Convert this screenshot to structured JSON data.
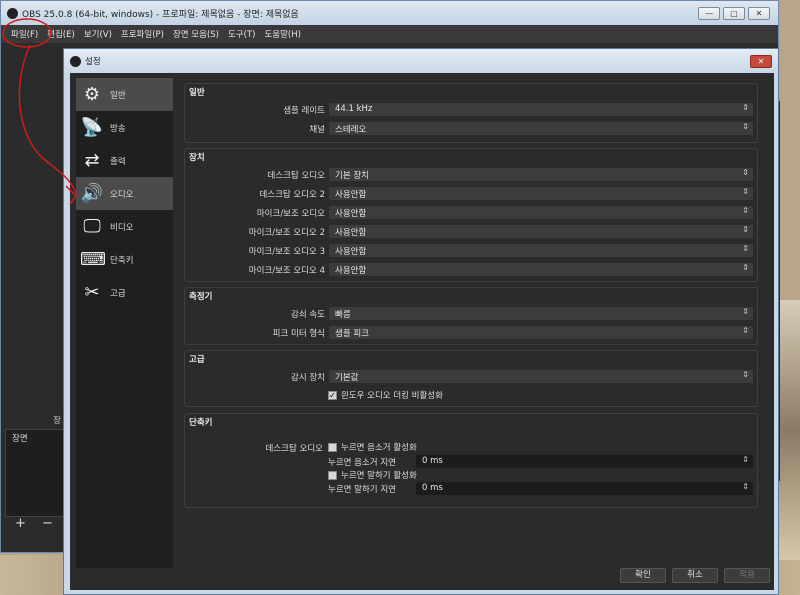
{
  "obs": {
    "title": "OBS 25.0.8 (64-bit, windows) - 프로파일: 제목없음 - 장면: 제목없음",
    "menu": [
      "파일(F)",
      "편집(E)",
      "보기(V)",
      "프로파일(P)",
      "장면 모음(S)",
      "도구(T)",
      "도움말(H)"
    ],
    "scene_header": "장",
    "scene_list_label": "장면",
    "scene_tools": "+ −"
  },
  "settings": {
    "title": "설정",
    "sidebar": [
      {
        "label": "일반",
        "icon": "gear-icon"
      },
      {
        "label": "방송",
        "icon": "antenna-icon"
      },
      {
        "label": "출력",
        "icon": "output-icon"
      },
      {
        "label": "오디오",
        "icon": "speaker-icon"
      },
      {
        "label": "비디오",
        "icon": "monitor-icon"
      },
      {
        "label": "단축키",
        "icon": "keyboard-icon"
      },
      {
        "label": "고급",
        "icon": "tools-icon"
      }
    ],
    "general": {
      "title": "일반",
      "rows": [
        {
          "label": "샘플 레이트",
          "value": "44.1 kHz"
        },
        {
          "label": "채널",
          "value": "스테레오"
        }
      ]
    },
    "devices": {
      "title": "장치",
      "rows": [
        {
          "label": "데스크탑 오디오",
          "value": "기본 장치"
        },
        {
          "label": "데스크탑 오디오 2",
          "value": "사용안함"
        },
        {
          "label": "마이크/보조 오디오",
          "value": "사용안함"
        },
        {
          "label": "마이크/보조 오디오 2",
          "value": "사용안함"
        },
        {
          "label": "마이크/보조 오디오 3",
          "value": "사용안함"
        },
        {
          "label": "마이크/보조 오디오 4",
          "value": "사용안함"
        }
      ]
    },
    "meters": {
      "title": "측정기",
      "rows": [
        {
          "label": "감쇠 속도",
          "value": "빠름"
        },
        {
          "label": "피크 미터 형식",
          "value": "샘플 피크"
        }
      ]
    },
    "advanced": {
      "title": "고급",
      "monitor_label": "감시 장치",
      "monitor_value": "기본값",
      "ducking_label": "윈도우 오디오 더킹 비활성화"
    },
    "hotkeys": {
      "title": "단축키",
      "source_label": "데스크탑 오디오",
      "ptm_enable": "누르면 음소거 활성화",
      "ptm_delay_label": "누르면 음소거 지연",
      "ptm_delay_value": "0 ms",
      "ptt_enable": "누르면 말하기 활성화",
      "ptt_delay_label": "누르면 말하기 지연",
      "ptt_delay_value": "0 ms"
    },
    "buttons": {
      "ok": "확인",
      "cancel": "취소",
      "apply": "적용"
    }
  }
}
